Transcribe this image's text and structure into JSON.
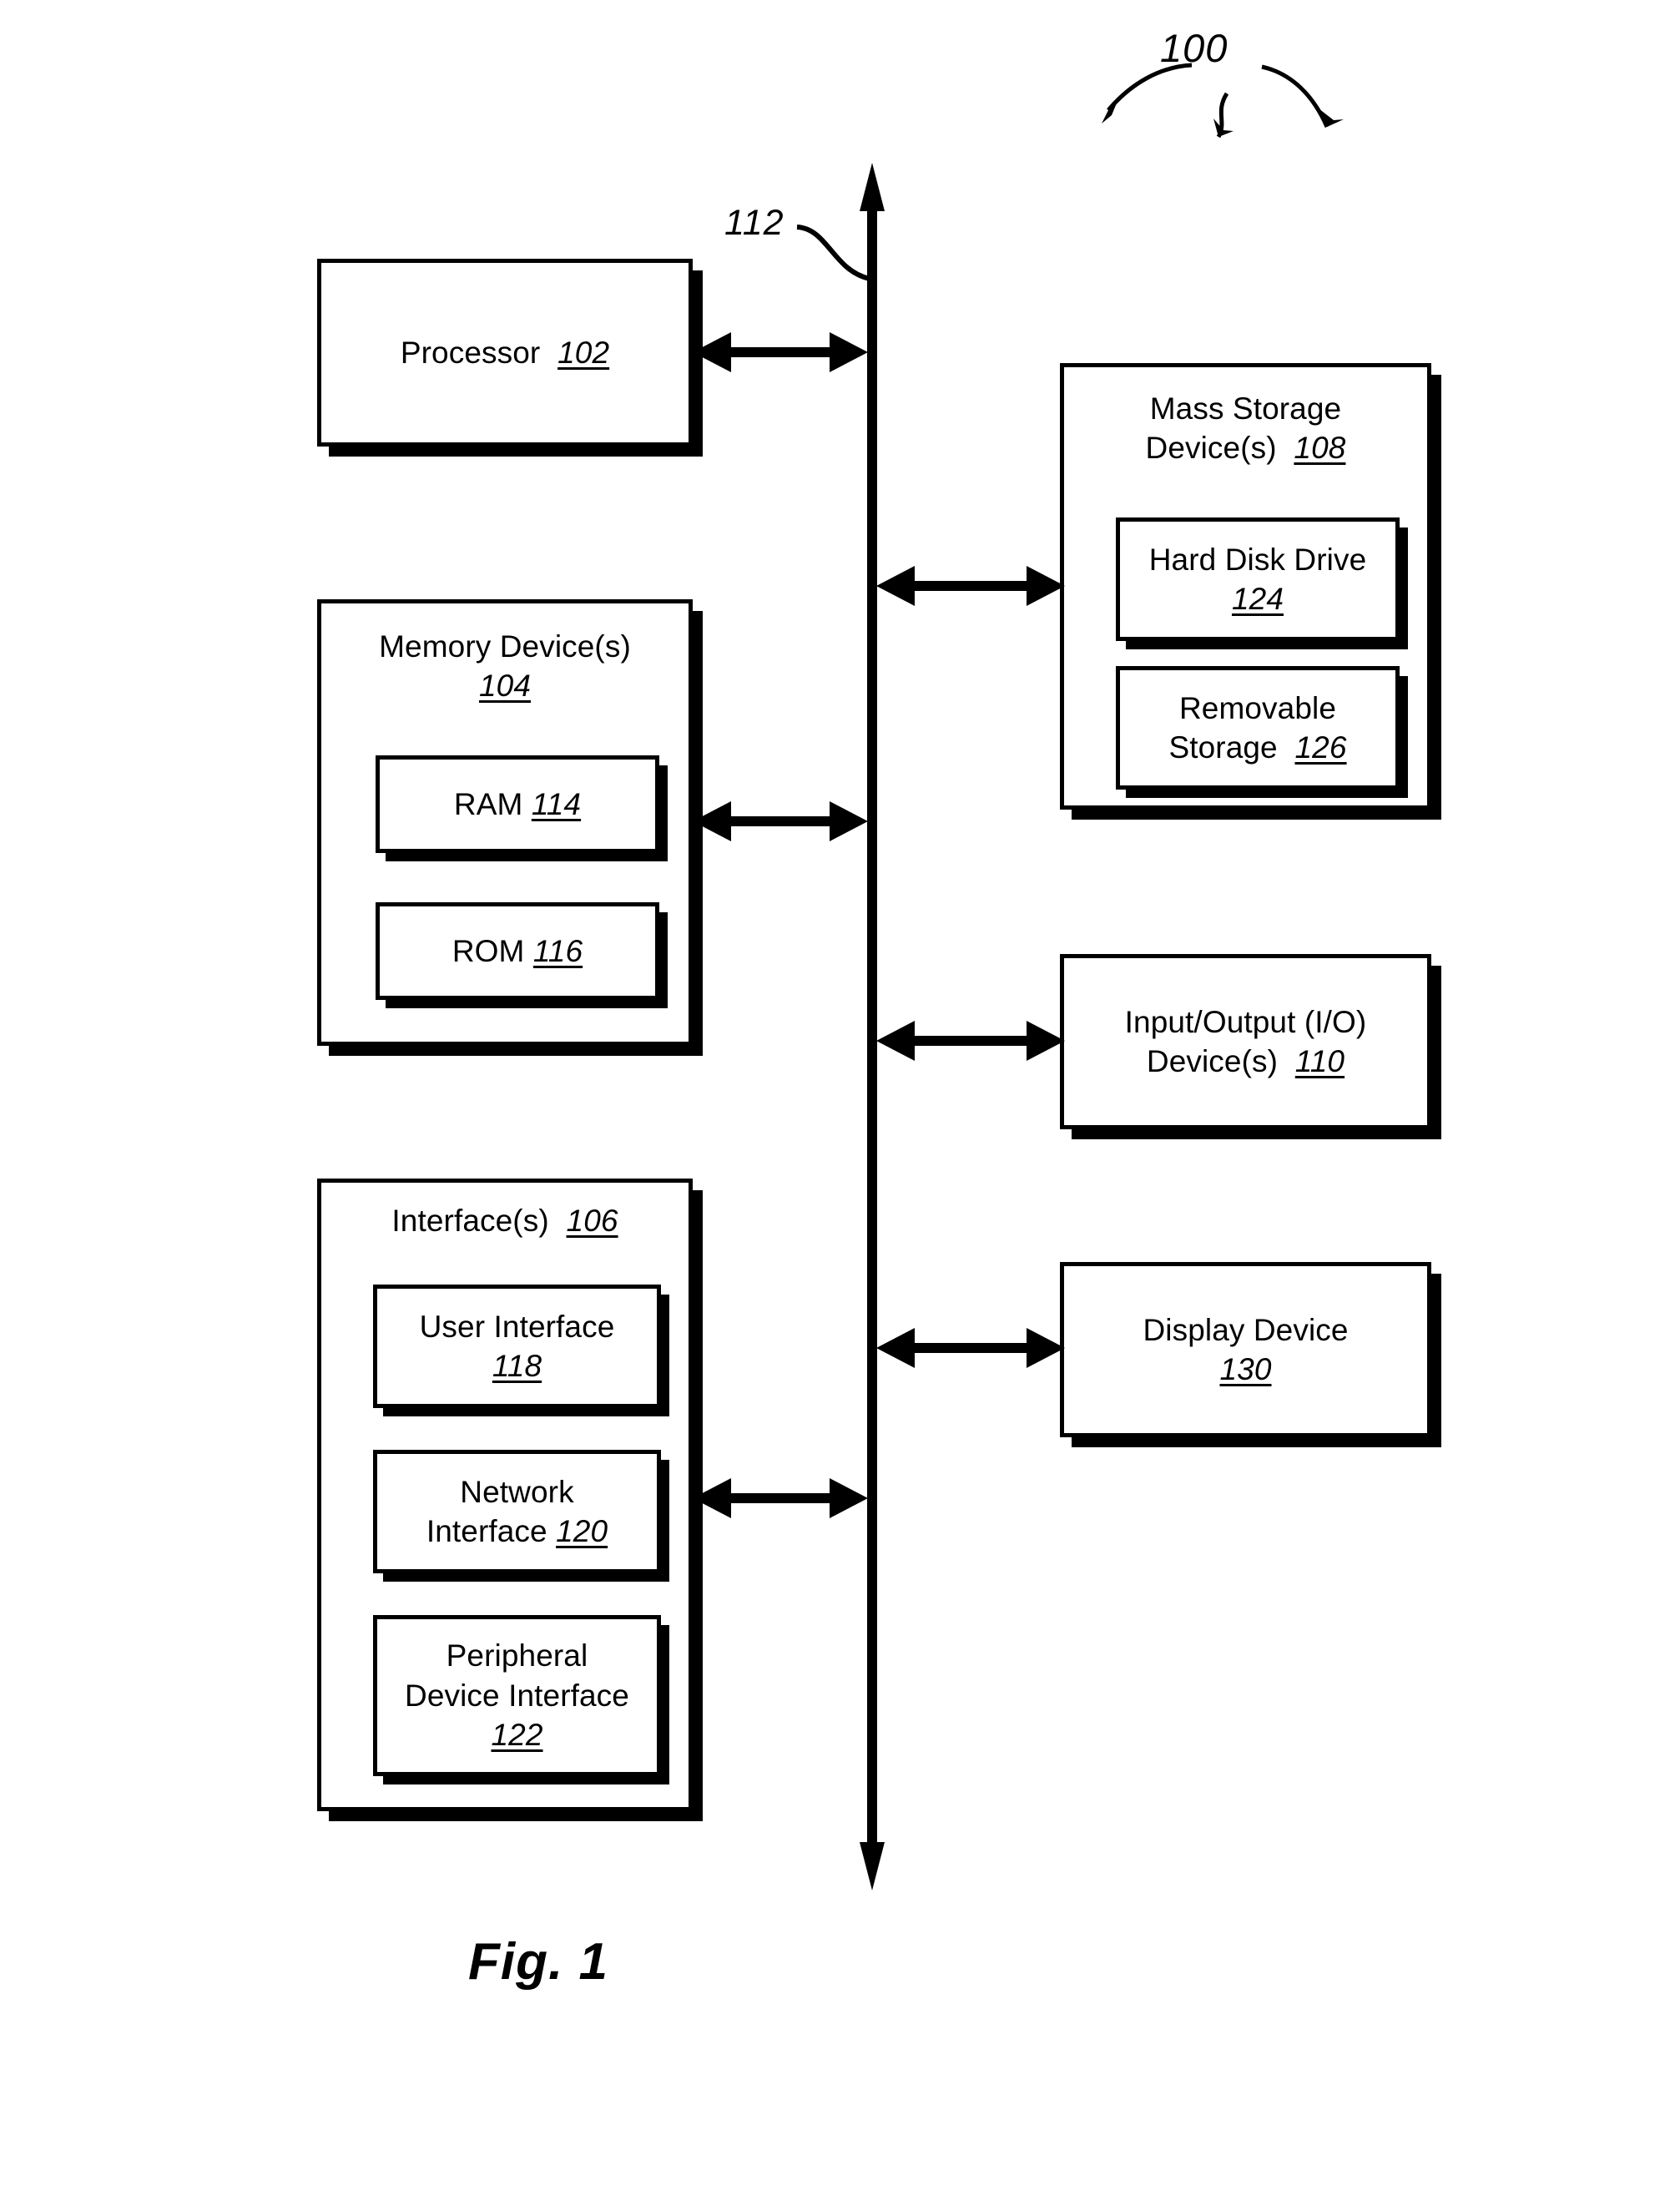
{
  "figure": {
    "caption": "Fig. 1",
    "system_ref": "100",
    "bus_ref": "112"
  },
  "left_column": {
    "processor": {
      "label": "Processor",
      "ref": "102"
    },
    "memory": {
      "label": "Memory Device(s)",
      "ref": "104",
      "children": [
        {
          "label": "RAM",
          "ref": "114"
        },
        {
          "label": "ROM",
          "ref": "116"
        }
      ]
    },
    "interfaces": {
      "label": "Interface(s)",
      "ref": "106",
      "children": [
        {
          "label": "User Interface",
          "ref": "118"
        },
        {
          "label": "Network\nInterface",
          "ref": "120"
        },
        {
          "label": "Peripheral\nDevice Interface",
          "ref": "122"
        }
      ]
    }
  },
  "right_column": {
    "mass_storage": {
      "label": "Mass Storage\nDevice(s)",
      "ref": "108",
      "children": [
        {
          "label": "Hard Disk Drive",
          "ref": "124"
        },
        {
          "label": "Removable\nStorage",
          "ref": "126"
        }
      ]
    },
    "io": {
      "label": "Input/Output (I/O)\nDevice(s)",
      "ref": "110"
    },
    "display": {
      "label": "Display Device",
      "ref": "130"
    }
  },
  "colors": {
    "stroke": "#000000",
    "background": "#ffffff"
  }
}
